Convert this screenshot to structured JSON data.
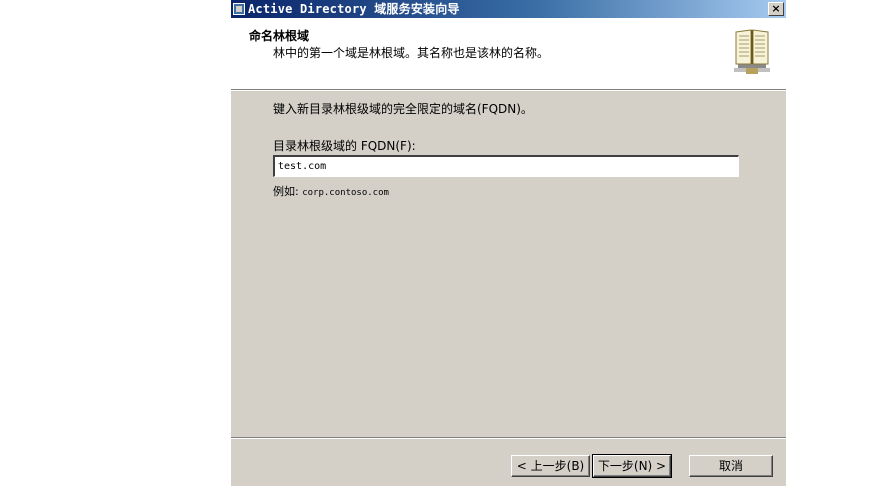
{
  "window": {
    "title": "Active Directory 域服务安装向导",
    "close_glyph": "×"
  },
  "header": {
    "title": "命名林根域",
    "subtitle": "林中的第一个域是林根域。其名称也是该林的名称。",
    "icon": "book-icon"
  },
  "content": {
    "instruction": "键入新目录林根级域的完全限定的域名(FQDN)。",
    "field_label": "目录林根级域的 FQDN(F):",
    "field_value": "test.com",
    "example_prefix": "例如:",
    "example_value": "corp.contoso.com"
  },
  "buttons": {
    "back": "< 上一步(B)",
    "next": "下一步(N) >",
    "cancel": "取消"
  }
}
